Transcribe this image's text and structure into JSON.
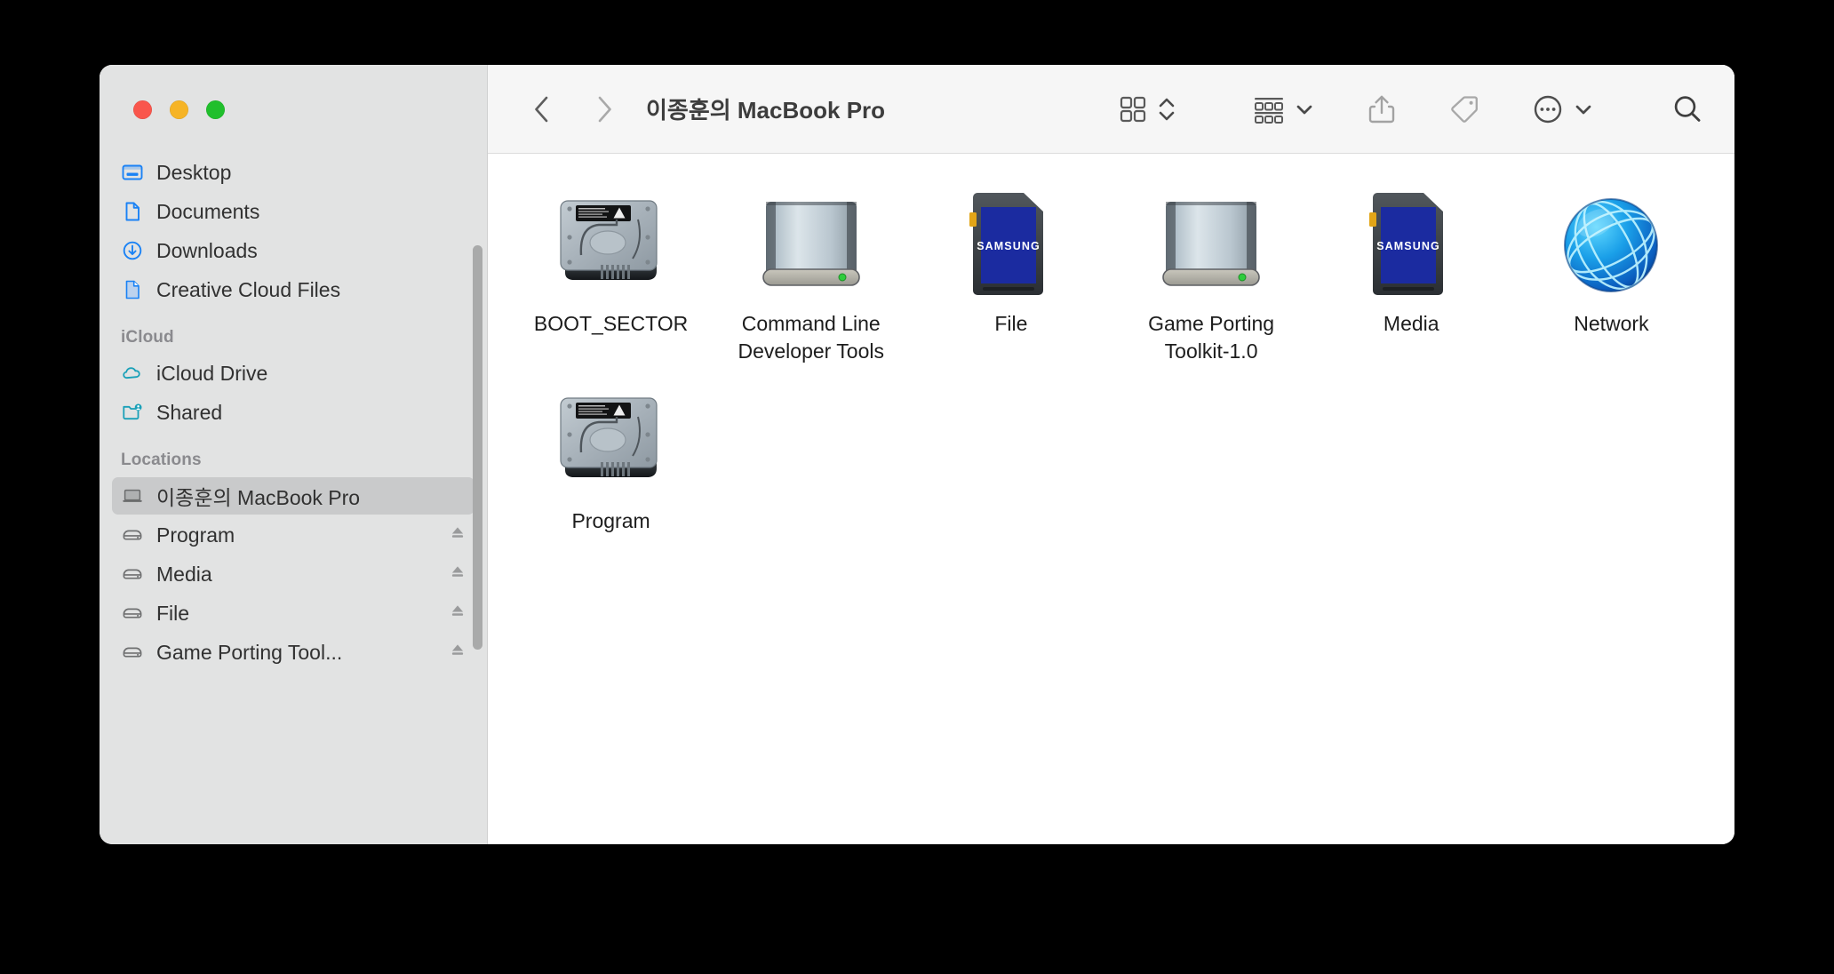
{
  "window": {
    "title": "이종훈의 MacBook Pro",
    "traffic_lights": [
      {
        "name": "close",
        "color": "#f9564c"
      },
      {
        "name": "minimize",
        "color": "#f6b426"
      },
      {
        "name": "zoom",
        "color": "#20bf2c"
      }
    ]
  },
  "toolbar": {
    "back_label": "Back",
    "forward_label": "Forward",
    "view_icon": "icon-view-grid-icon",
    "view_sort_label": "Arrange",
    "group_label": "Group",
    "share_label": "Share",
    "tags_label": "Tags",
    "more_label": "More",
    "search_label": "Search"
  },
  "sidebar": {
    "sections": [
      {
        "title": "",
        "items": [
          {
            "label": "Desktop",
            "icon": "desktop-icon",
            "eject": false,
            "selected": false
          },
          {
            "label": "Documents",
            "icon": "document-icon",
            "eject": false,
            "selected": false
          },
          {
            "label": "Downloads",
            "icon": "downloads-icon",
            "eject": false,
            "selected": false
          },
          {
            "label": "Creative Cloud Files",
            "icon": "creative-cloud-files-icon",
            "eject": false,
            "selected": false
          }
        ]
      },
      {
        "title": "iCloud",
        "items": [
          {
            "label": "iCloud Drive",
            "icon": "icloud-drive-icon",
            "eject": false,
            "selected": false
          },
          {
            "label": "Shared",
            "icon": "shared-folder-icon",
            "eject": false,
            "selected": false
          }
        ]
      },
      {
        "title": "Locations",
        "items": [
          {
            "label": "이종훈의 MacBook Pro",
            "icon": "laptop-icon",
            "eject": false,
            "selected": true
          },
          {
            "label": "Program",
            "icon": "external-drive-icon",
            "eject": true,
            "selected": false
          },
          {
            "label": "Media",
            "icon": "external-drive-icon",
            "eject": true,
            "selected": false
          },
          {
            "label": "File",
            "icon": "external-drive-icon",
            "eject": true,
            "selected": false
          },
          {
            "label": "Game Porting Tool...",
            "icon": "external-drive-icon",
            "eject": true,
            "selected": false
          }
        ]
      }
    ]
  },
  "content": {
    "items": [
      {
        "label": "BOOT_SECTOR",
        "icon": "internal-hard-drive-icon"
      },
      {
        "label": "Command Line Developer Tools",
        "icon": "removable-drive-icon"
      },
      {
        "label": "File",
        "icon": "sd-card-icon",
        "card_brand": "SAMSUNG"
      },
      {
        "label": "Game Porting Toolkit-1.0",
        "icon": "removable-drive-icon"
      },
      {
        "label": "Media",
        "icon": "sd-card-icon",
        "card_brand": "SAMSUNG"
      },
      {
        "label": "Network",
        "icon": "network-globe-icon"
      },
      {
        "label": "Program",
        "icon": "internal-hard-drive-icon"
      }
    ]
  },
  "colors": {
    "accent_blue": "#1a82f5",
    "icloud_teal": "#19a0b8",
    "sidebar_bg": "#e2e3e3",
    "toolbar_bg": "#f6f6f6",
    "selected_bg": "#c9cacb"
  }
}
